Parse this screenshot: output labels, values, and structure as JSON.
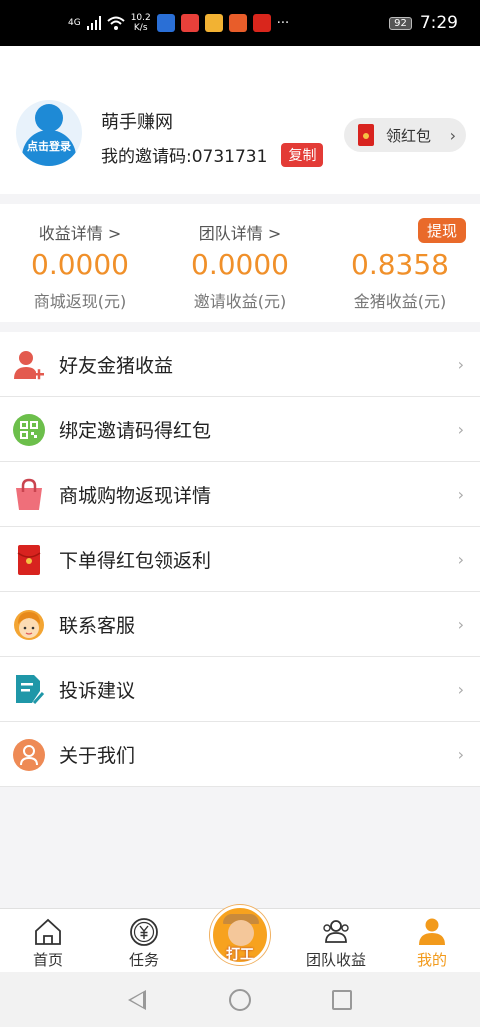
{
  "status_bar": {
    "network": "4G",
    "speed_value": "10.2",
    "speed_unit": "K/s",
    "battery": "92",
    "time": "7:29"
  },
  "profile": {
    "avatar_label": "点击登录",
    "site_name": "萌手赚网",
    "invite_code_label": "我的邀请码:0731731",
    "copy_label": "复制",
    "redpack_label": "领红包"
  },
  "stats": {
    "withdraw_label": "提现",
    "items": [
      {
        "link": "收益详情 >",
        "value": "0.0000",
        "label": "商城返现(元)"
      },
      {
        "link": "团队详情 >",
        "value": "0.0000",
        "label": "邀请收益(元)"
      },
      {
        "link": "",
        "value": "0.8358",
        "label": "金猪收益(元)"
      }
    ]
  },
  "menu": {
    "items": [
      {
        "label": "好友金猪收益",
        "icon": "add-friend-icon"
      },
      {
        "label": "绑定邀请码得红包",
        "icon": "qr-code-icon"
      },
      {
        "label": "商城购物返现详情",
        "icon": "shopping-bag-icon"
      },
      {
        "label": "下单得红包领返利",
        "icon": "red-envelope-icon"
      },
      {
        "label": "联系客服",
        "icon": "customer-service-icon"
      },
      {
        "label": "投诉建议",
        "icon": "feedback-icon"
      },
      {
        "label": "关于我们",
        "icon": "about-icon"
      }
    ]
  },
  "tabbar": {
    "items": [
      {
        "label": "首页",
        "icon": "home-icon"
      },
      {
        "label": "任务",
        "icon": "yuan-coin-icon"
      },
      {
        "label": "打工",
        "icon": "worker-icon"
      },
      {
        "label": "团队收益",
        "icon": "team-icon"
      },
      {
        "label": "我的",
        "icon": "profile-icon"
      }
    ],
    "active_index": 4
  },
  "colors": {
    "accent": "#f0902a",
    "red": "#e33b36",
    "blue": "#1e8ad6"
  }
}
